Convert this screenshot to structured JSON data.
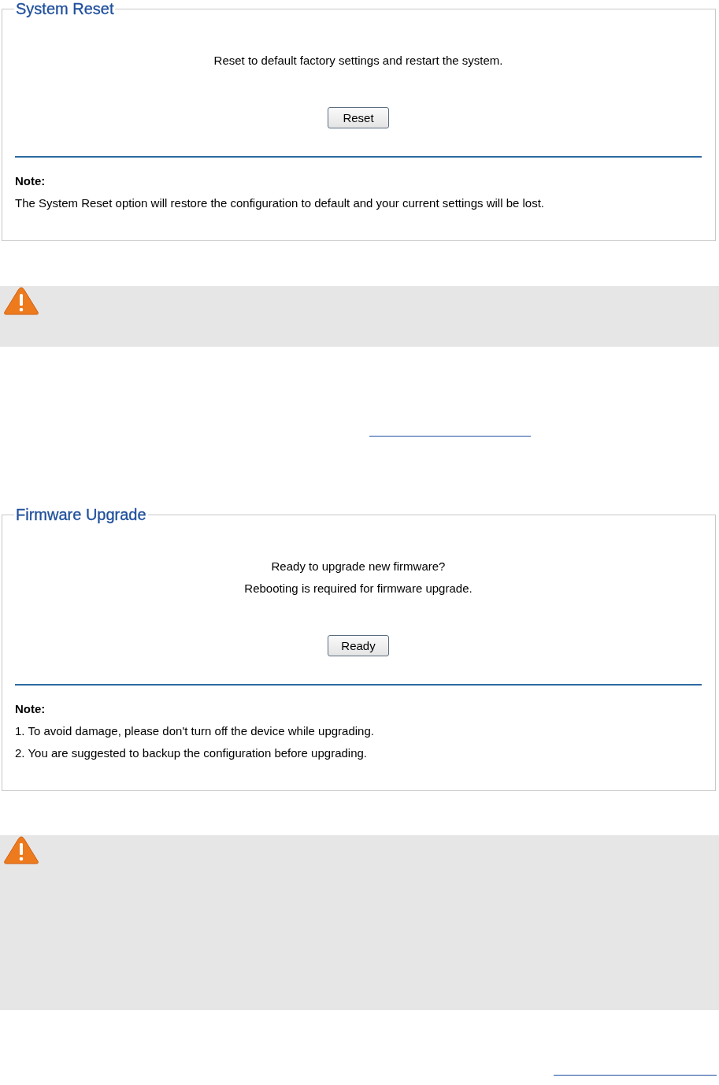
{
  "sections": [
    {
      "kind": "panel",
      "title": "System Reset",
      "messages": [
        "Reset to default factory settings and restart the system."
      ],
      "button": "Reset",
      "note_label": "Note:",
      "notes": [
        "The System Reset option will restore the configuration to default and your current settings will be lost."
      ]
    },
    {
      "kind": "warning"
    },
    {
      "kind": "rule"
    },
    {
      "kind": "panel",
      "title": "Firmware Upgrade",
      "messages": [
        "Ready to upgrade new firmware?",
        "Rebooting is required for firmware upgrade."
      ],
      "button": "Ready",
      "note_label": "Note:",
      "notes": [
        "1. To avoid damage, please don't turn off the device while upgrading.",
        "2. You are suggested to backup the configuration before upgrading."
      ]
    },
    {
      "kind": "warning"
    },
    {
      "kind": "rule"
    }
  ]
}
